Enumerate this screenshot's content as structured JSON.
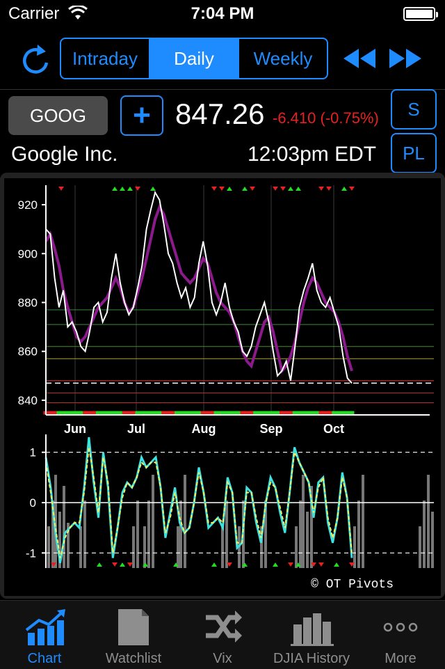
{
  "status_bar": {
    "carrier": "Carrier",
    "time": "7:04 PM"
  },
  "toolbar": {
    "segments": [
      {
        "label": "Intraday",
        "active": false
      },
      {
        "label": "Daily",
        "active": true
      },
      {
        "label": "Weekly",
        "active": false
      }
    ],
    "icons": [
      "refresh-icon",
      "rewind-icon",
      "fast-forward-icon"
    ]
  },
  "quote": {
    "symbol": "GOOG",
    "add_label": "+",
    "price": "847.26",
    "change": "-6.410 (-0.75%)",
    "company": "Google Inc.",
    "time": "12:03pm EDT",
    "s_label": "S",
    "pl_label": "PL"
  },
  "colors": {
    "accent": "#1e8cff",
    "down": "#e82020",
    "up": "#22dd22",
    "ma": "#8c1a8c",
    "osc": "#3fe0e0",
    "signal": "#f0f060"
  },
  "chart_data": [
    {
      "type": "line",
      "title": "",
      "xlabel": "",
      "ylabel": "",
      "x_ticks": [
        "Jun",
        "Jul",
        "Aug",
        "Sep",
        "Oct"
      ],
      "y_ticks": [
        840,
        860,
        880,
        900,
        920
      ],
      "ylim": [
        834,
        928
      ],
      "series": [
        {
          "values": [
            910,
            908,
            890,
            878,
            885,
            870,
            872,
            868,
            862,
            860,
            868,
            878,
            880,
            872,
            876,
            890,
            900,
            888,
            880,
            875,
            878,
            886,
            895,
            910,
            918,
            925,
            922,
            912,
            900,
            896,
            888,
            882,
            886,
            878,
            882,
            896,
            905,
            895,
            880,
            875,
            880,
            888,
            878,
            872,
            868,
            860,
            858,
            862,
            870,
            875,
            880,
            872,
            860,
            850,
            852,
            856,
            848,
            862,
            878,
            885,
            890,
            896,
            885,
            880,
            878,
            882,
            876,
            870,
            858,
            849,
            847
          ]
        },
        {
          "values": [
            905,
            908,
            902,
            895,
            885,
            878,
            872,
            866,
            864,
            866,
            870,
            874,
            878,
            880,
            882,
            886,
            890,
            886,
            880,
            876,
            878,
            884,
            890,
            898,
            906,
            914,
            919,
            916,
            910,
            904,
            898,
            892,
            890,
            888,
            890,
            894,
            898,
            896,
            890,
            884,
            880,
            878,
            876,
            872,
            866,
            860,
            856,
            854,
            860,
            866,
            872,
            874,
            868,
            860,
            852,
            854,
            858,
            864,
            872,
            880,
            886,
            890,
            888,
            884,
            880,
            878,
            876,
            872,
            866,
            858,
            852
          ]
        }
      ],
      "horizontal_levels": [
        877,
        871,
        862,
        857,
        848,
        847,
        843,
        839
      ],
      "last_value": 847.26
    },
    {
      "type": "line",
      "y_ticks": [
        1,
        0,
        -1
      ],
      "ylim": [
        -1.3,
        1.3
      ],
      "series": [
        {
          "values": [
            0.9,
            0.3,
            -0.6,
            -1.2,
            -0.6,
            -0.5,
            -0.4,
            -0.5,
            0.3,
            1.3,
            0.4,
            -0.3,
            1.0,
            0.3,
            -1.1,
            -0.5,
            0.2,
            0.4,
            0.3,
            0.5,
            0.9,
            0.7,
            0.8,
            0.9,
            0.3,
            -0.7,
            -0.2,
            0.3,
            -0.4,
            -0.6,
            -0.5,
            0.0,
            0.7,
            0.2,
            -0.5,
            -0.4,
            -0.3,
            -0.5,
            0.5,
            0.2,
            -0.9,
            -0.8,
            0.3,
            0.2,
            -0.4,
            -0.8,
            0.0,
            0.5,
            0.3,
            -0.2,
            -0.6,
            0.2,
            1.1,
            0.8,
            0.6,
            0.4,
            -0.3,
            0.4,
            0.5,
            -0.4,
            -0.8,
            -0.3,
            0.6,
            0.1,
            -1.1
          ]
        },
        {
          "values": [
            0.8,
            0.2,
            -0.5,
            -1.1,
            -0.7,
            -0.5,
            -0.4,
            -0.4,
            0.2,
            1.1,
            0.5,
            -0.2,
            0.9,
            0.4,
            -1.0,
            -0.5,
            0.1,
            0.4,
            0.3,
            0.5,
            0.8,
            0.7,
            0.8,
            0.8,
            0.3,
            -0.6,
            -0.3,
            0.2,
            -0.3,
            -0.6,
            -0.5,
            0.0,
            0.6,
            0.2,
            -0.4,
            -0.4,
            -0.3,
            -0.4,
            0.4,
            0.2,
            -0.8,
            -0.8,
            0.2,
            0.2,
            -0.3,
            -0.7,
            0.0,
            0.4,
            0.3,
            -0.1,
            -0.5,
            0.2,
            1.0,
            0.8,
            0.6,
            0.4,
            -0.2,
            0.3,
            0.5,
            -0.3,
            -0.7,
            -0.3,
            0.5,
            0.1,
            -1.0
          ]
        }
      ]
    }
  ],
  "watermark": "© OT Pivots",
  "tabs": [
    {
      "label": "Chart",
      "icon": "chart-icon",
      "active": true
    },
    {
      "label": "Watchlist",
      "icon": "document-icon",
      "active": false
    },
    {
      "label": "Vix",
      "icon": "shuffle-icon",
      "active": false
    },
    {
      "label": "DJIA History",
      "icon": "bar-chart-icon",
      "active": false
    },
    {
      "label": "More",
      "icon": "more-icon",
      "active": false
    }
  ]
}
